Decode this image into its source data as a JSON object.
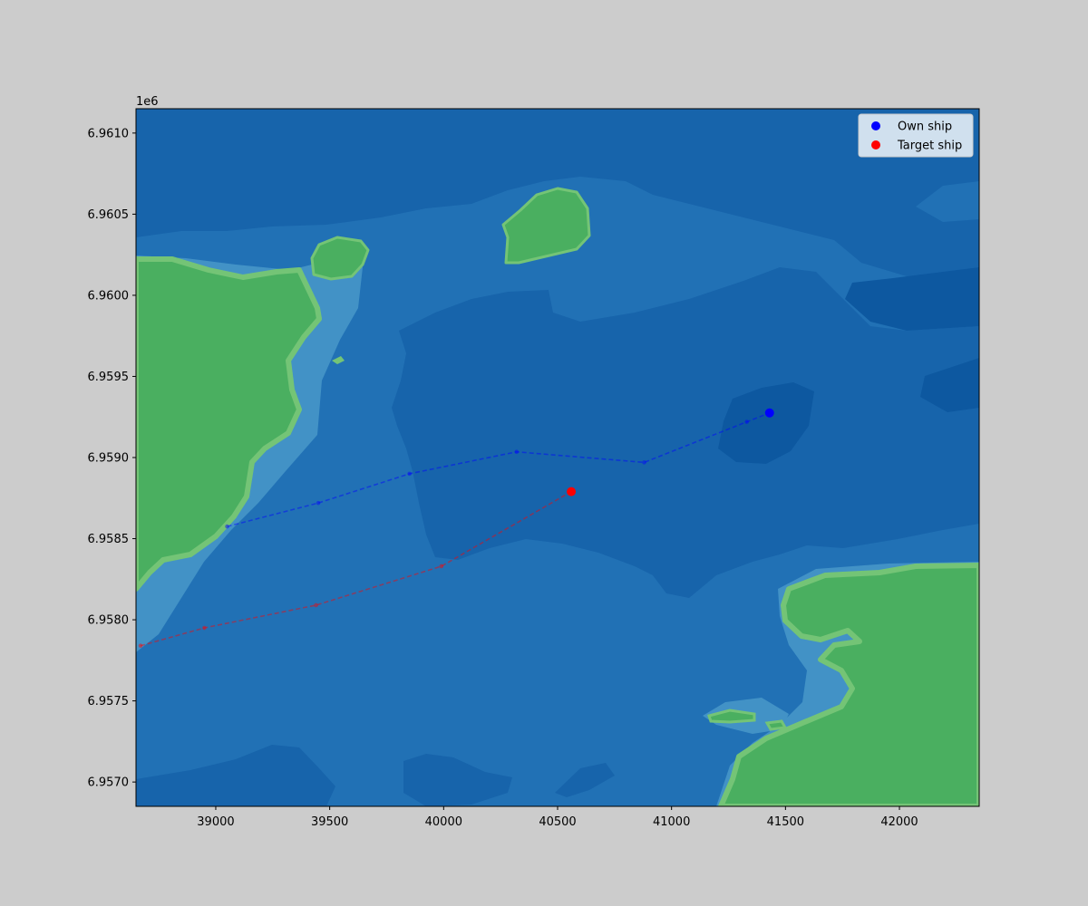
{
  "chart_data": {
    "type": "scatter",
    "title": "",
    "xlabel": "",
    "ylabel": "",
    "y_offset_label": "1e6",
    "xlim": [
      38650,
      42350
    ],
    "ylim": [
      6956850,
      6961150
    ],
    "x_ticks": [
      39000,
      39500,
      40000,
      40500,
      41000,
      41500,
      42000
    ],
    "x_tick_labels": [
      "39000",
      "39500",
      "40000",
      "40500",
      "41000",
      "41500",
      "42000"
    ],
    "y_ticks": [
      6957000,
      6957500,
      6958000,
      6958500,
      6959000,
      6959500,
      6960000,
      6960500,
      6961000
    ],
    "y_tick_labels": [
      "6.9570",
      "6.9575",
      "6.9580",
      "6.9585",
      "6.9590",
      "6.9595",
      "6.9600",
      "6.9605",
      "6.9610"
    ],
    "grid": false,
    "legend_position": "top-right",
    "series": [
      {
        "name": "Own ship",
        "color": "#0000ff",
        "current_position": {
          "x": 41430,
          "y": 6959275
        },
        "track": [
          {
            "x": 39050,
            "y": 6958575
          },
          {
            "x": 39450,
            "y": 6958720
          },
          {
            "x": 39850,
            "y": 6958900
          },
          {
            "x": 40320,
            "y": 6959035
          },
          {
            "x": 40880,
            "y": 6958970
          },
          {
            "x": 41330,
            "y": 6959220
          },
          {
            "x": 41430,
            "y": 6959275
          }
        ]
      },
      {
        "name": "Target ship",
        "color": "#ff0000",
        "current_position": {
          "x": 40560,
          "y": 6958790
        },
        "track": [
          {
            "x": 38670,
            "y": 6957840
          },
          {
            "x": 38950,
            "y": 6957950
          },
          {
            "x": 39440,
            "y": 6958090
          },
          {
            "x": 39990,
            "y": 6958330
          },
          {
            "x": 40560,
            "y": 6958790
          }
        ]
      }
    ],
    "background": {
      "water_colors": [
        "#2171b5",
        "#1764ab",
        "#0d58a0",
        "#4292c6"
      ],
      "land_colors": [
        "#4aaf60",
        "#74c476"
      ]
    }
  }
}
